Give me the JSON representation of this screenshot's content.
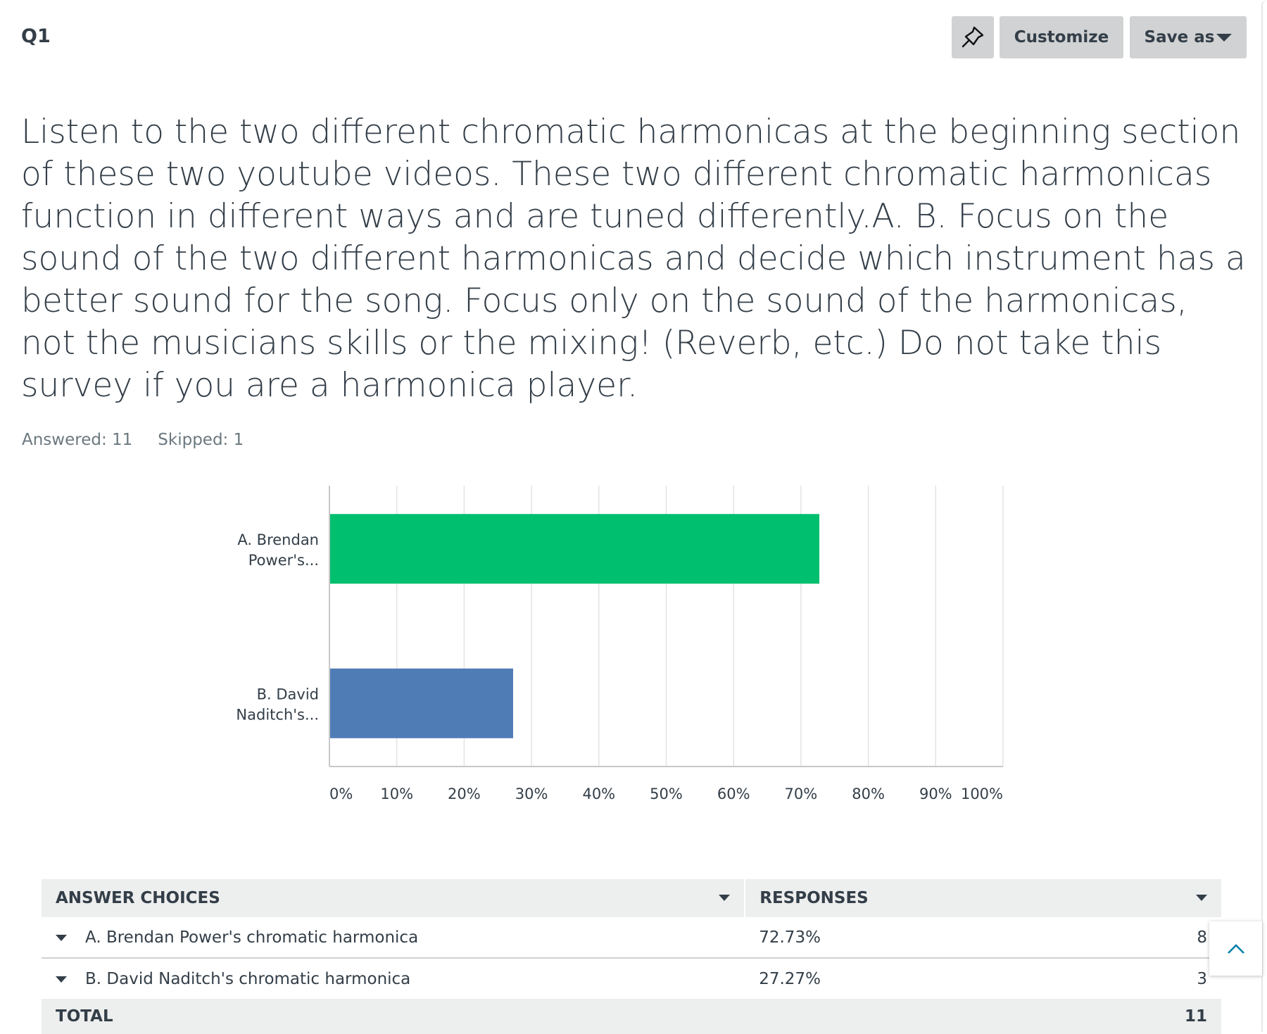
{
  "header": {
    "question_number": "Q1",
    "pin_icon": "pin-icon",
    "customize_label": "Customize",
    "save_as_label": "Save as"
  },
  "question": {
    "text": "Listen to the two different chromatic harmonicas at the beginning section of these two youtube videos.  These two different chromatic harmonicas function in different ways and are tuned differently.A. B. Focus on the sound of the two different harmonicas and decide which instrument has a better sound for the song.  Focus only on the sound of the harmonicas, not the musicians skills or the mixing!  (Reverb, etc.)  Do not take this survey if you are a harmonica player."
  },
  "stats": {
    "answered": "Answered: 11",
    "skipped": "Skipped: 1"
  },
  "chart_data": {
    "type": "bar",
    "orientation": "horizontal",
    "categories": [
      [
        "A. Brendan",
        "Power's..."
      ],
      [
        "B. David",
        "Naditch's..."
      ]
    ],
    "values": [
      72.73,
      27.27
    ],
    "colors": [
      "#00bf6f",
      "#507cb6"
    ],
    "xlim": [
      0,
      100
    ],
    "xticks": [
      "0%",
      "10%",
      "20%",
      "30%",
      "40%",
      "50%",
      "60%",
      "70%",
      "80%",
      "90%",
      "100%"
    ],
    "grid": true
  },
  "table": {
    "headers": [
      "ANSWER CHOICES",
      "RESPONSES"
    ],
    "rows": [
      {
        "choice": "A.  Brendan Power's chromatic harmonica",
        "percent": "72.73%",
        "count": "8"
      },
      {
        "choice": "B.  David Naditch's chromatic harmonica",
        "percent": "27.27%",
        "count": "3"
      }
    ],
    "total_label": "TOTAL",
    "total": "11"
  },
  "colors": {
    "accent_green": "#00bf6f",
    "accent_blue": "#507cb6",
    "text": "#333e48",
    "scroll_top": "#007faa"
  }
}
